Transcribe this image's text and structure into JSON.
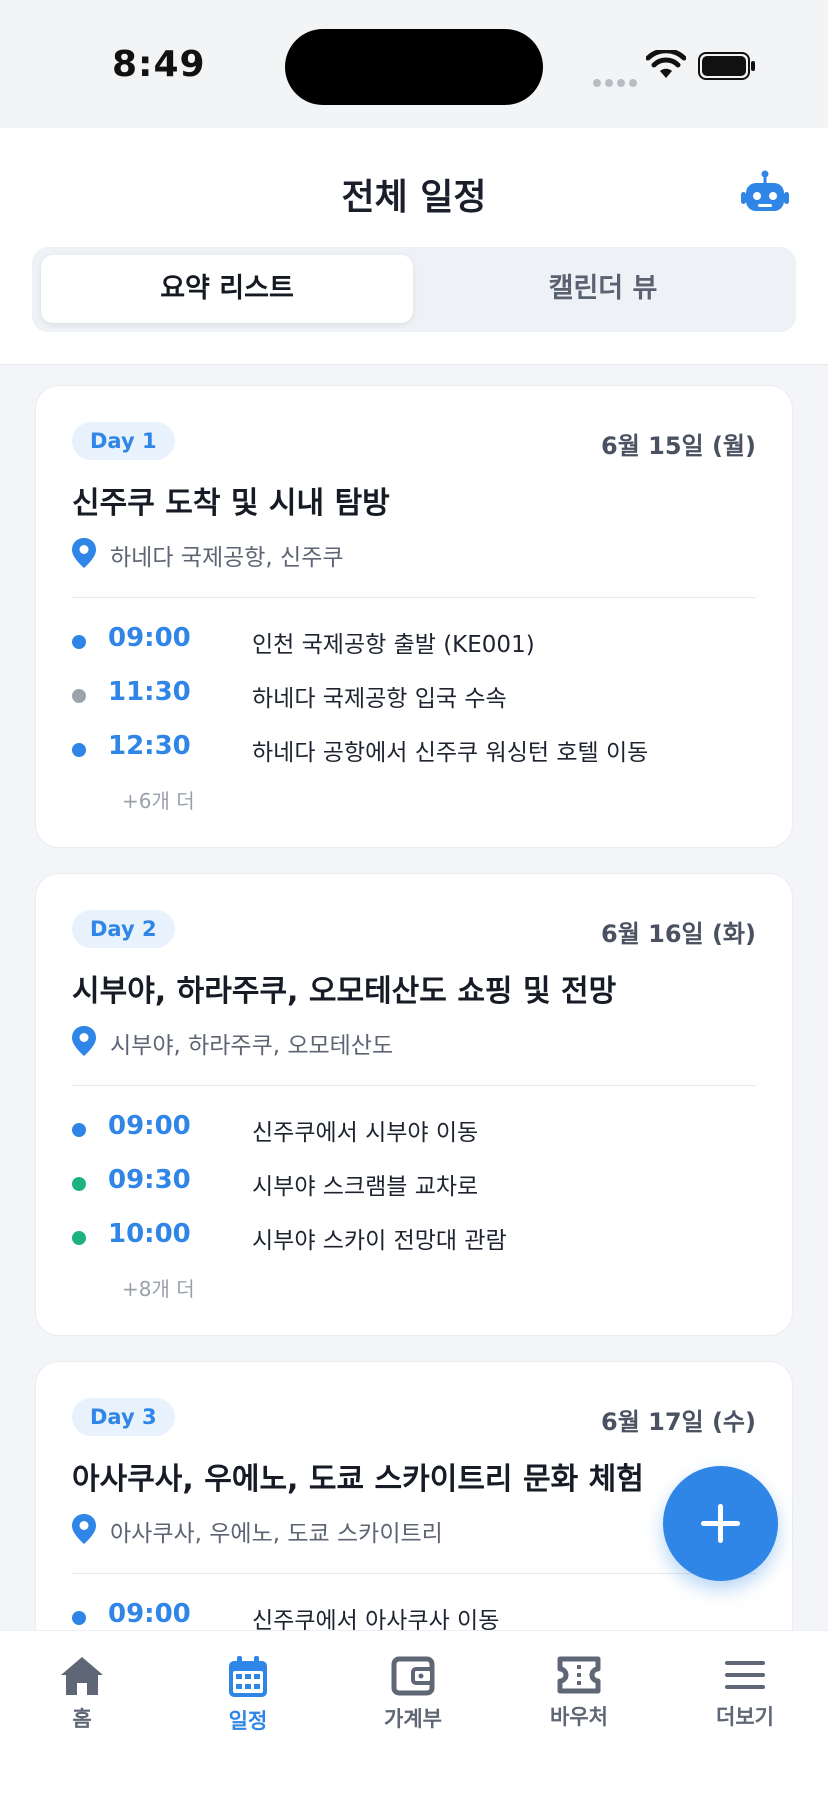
{
  "status_bar": {
    "time": "8:49"
  },
  "header": {
    "title": "전체 일정",
    "bot_icon": "robot-icon",
    "segments": [
      {
        "label": "요약 리스트",
        "active": true
      },
      {
        "label": "캘린더 뷰",
        "active": false
      }
    ]
  },
  "days": [
    {
      "badge": "Day 1",
      "date": "6월 15일 (월)",
      "title": "신주쿠 도착 및 시내 탐방",
      "location": "하네다 국제공항, 신주쿠",
      "events": [
        {
          "time": "09:00",
          "text": "인천 국제공항 출발 (KE001)",
          "dot_color": "#2f86e6"
        },
        {
          "time": "11:30",
          "text": "하네다 국제공항 입국 수속",
          "dot_color": "#9ca3af"
        },
        {
          "time": "12:30",
          "text": "하네다 공항에서 신주쿠 워싱턴 호텔 이동",
          "dot_color": "#2f86e6"
        }
      ],
      "more": "+6개 더"
    },
    {
      "badge": "Day 2",
      "date": "6월 16일 (화)",
      "title": "시부야, 하라주쿠, 오모테산도 쇼핑 및 전망",
      "location": "시부야, 하라주쿠, 오모테산도",
      "events": [
        {
          "time": "09:00",
          "text": "신주쿠에서 시부야 이동",
          "dot_color": "#2f86e6"
        },
        {
          "time": "09:30",
          "text": "시부야 스크램블 교차로",
          "dot_color": "#1db37e"
        },
        {
          "time": "10:00",
          "text": "시부야 스카이 전망대 관람",
          "dot_color": "#1db37e"
        }
      ],
      "more": "+8개 더"
    },
    {
      "badge": "Day 3",
      "date": "6월 17일 (수)",
      "title": "아사쿠사, 우에노, 도쿄 스카이트리 문화 체험",
      "location": "아사쿠사, 우에노, 도쿄 스카이트리",
      "events": [
        {
          "time": "09:00",
          "text": "신주쿠에서 아사쿠사 이동",
          "dot_color": "#2f86e6"
        }
      ],
      "more": ""
    }
  ],
  "fab": {
    "icon": "plus-icon"
  },
  "tab_bar": [
    {
      "label": "홈",
      "icon": "home-icon",
      "active": false
    },
    {
      "label": "일정",
      "icon": "calendar-icon",
      "active": true
    },
    {
      "label": "가계부",
      "icon": "wallet-icon",
      "active": false
    },
    {
      "label": "바우처",
      "icon": "ticket-icon",
      "active": false
    },
    {
      "label": "더보기",
      "icon": "menu-icon",
      "active": false
    }
  ],
  "colors": {
    "accent": "#2f86e6",
    "background": "#f3f5f8"
  }
}
